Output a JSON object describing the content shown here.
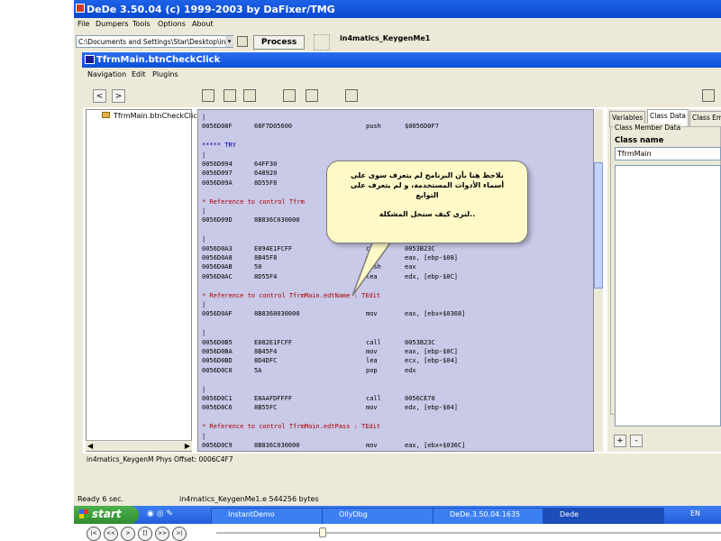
{
  "outer": {
    "title": "DeDe 3.50.04 (c) 1999-2003 by DaFixer/TMG",
    "menu": [
      "File",
      "Dumpers",
      "Tools",
      "Options",
      "About"
    ],
    "path": "C:\\Documents and Settings\\Star\\Desktop\\in",
    "process_label": "Process",
    "project_name": "in4matics_KeygenMe1",
    "status_left": "Ready 6 sec.",
    "status_file": "in4matics_KeygenMe1.e 544256 bytes"
  },
  "inner": {
    "title": "TfrmMain.btnCheckClick",
    "menu": [
      "Navigation",
      "Edit",
      "Plugins"
    ],
    "nav_back": "<",
    "nav_forward": ">",
    "tree_item": "TfrmMain.btnCheckClick",
    "status_project": "in4matics_KeygenM",
    "status_offset": "Phys Offset: 0006C4F7"
  },
  "code_lines": [
    {
      "kind": "plain",
      "text": "|"
    },
    {
      "kind": "asm",
      "addr": "0056D08F",
      "hex": "68F7D05600",
      "mn": "push",
      "op": "$0056D0F7"
    },
    {
      "kind": "blank",
      "text": ""
    },
    {
      "kind": "try",
      "text": "***** TRY"
    },
    {
      "kind": "plain",
      "text": "|"
    },
    {
      "kind": "asm",
      "addr": "0056D094",
      "hex": "64FF30",
      "mn": "",
      "op": ""
    },
    {
      "kind": "asm",
      "addr": "0056D097",
      "hex": "648920",
      "mn": "",
      "op": ""
    },
    {
      "kind": "asm",
      "addr": "0056D09A",
      "hex": "8D55F8",
      "mn": "",
      "op": ""
    },
    {
      "kind": "blank",
      "text": ""
    },
    {
      "kind": "ref",
      "text": "* Reference to control Tfrm"
    },
    {
      "kind": "plain",
      "text": "|"
    },
    {
      "kind": "asm",
      "addr": "0056D09D",
      "hex": "8B836C030000",
      "mn": "",
      "op": ""
    },
    {
      "kind": "blank",
      "text": ""
    },
    {
      "kind": "plain",
      "text": "|"
    },
    {
      "kind": "asm",
      "addr": "0056D0A3",
      "hex": "E894E1FCFF",
      "mn": "call",
      "op": "0053B23C"
    },
    {
      "kind": "asm",
      "addr": "0056D0A8",
      "hex": "8B45F8",
      "mn": "mov",
      "op": "eax, [ebp-$08]"
    },
    {
      "kind": "asm",
      "addr": "0056D0AB",
      "hex": "50",
      "mn": "push",
      "op": "eax"
    },
    {
      "kind": "asm",
      "addr": "0056D0AC",
      "hex": "8D55F4",
      "mn": "lea",
      "op": "edx, [ebp-$0C]"
    },
    {
      "kind": "blank",
      "text": ""
    },
    {
      "kind": "ref",
      "text": "* Reference to control TfrmMain.edtName : TEdit"
    },
    {
      "kind": "plain",
      "text": "|"
    },
    {
      "kind": "asm",
      "addr": "0056D0AF",
      "hex": "8B8368030000",
      "mn": "mov",
      "op": "eax, [ebx+$0368]"
    },
    {
      "kind": "blank",
      "text": ""
    },
    {
      "kind": "plain",
      "text": "|"
    },
    {
      "kind": "asm",
      "addr": "0056D0B5",
      "hex": "E882E1FCFF",
      "mn": "call",
      "op": "0053B23C"
    },
    {
      "kind": "asm",
      "addr": "0056D0BA",
      "hex": "8B45F4",
      "mn": "mov",
      "op": "eax, [ebp-$0C]"
    },
    {
      "kind": "asm",
      "addr": "0056D0BD",
      "hex": "8D4DFC",
      "mn": "lea",
      "op": "ecx, [ebp-$04]"
    },
    {
      "kind": "asm",
      "addr": "0056D0C0",
      "hex": "5A",
      "mn": "pop",
      "op": "edx"
    },
    {
      "kind": "blank",
      "text": ""
    },
    {
      "kind": "plain",
      "text": "|"
    },
    {
      "kind": "asm",
      "addr": "0056D0C1",
      "hex": "E8AAFDFFFF",
      "mn": "call",
      "op": "0056CE70"
    },
    {
      "kind": "asm",
      "addr": "0056D0C6",
      "hex": "8B55FC",
      "mn": "mov",
      "op": "edx, [ebp-$04]"
    },
    {
      "kind": "blank",
      "text": ""
    },
    {
      "kind": "ref",
      "text": "* Reference to control TfrmMain.edtPass : TEdit"
    },
    {
      "kind": "plain",
      "text": "|"
    },
    {
      "kind": "asm",
      "addr": "0056D0C9",
      "hex": "8B836C030000",
      "mn": "mov",
      "op": "eax, [ebx+$036C]"
    }
  ],
  "balloon": {
    "line1": "نلاحظ هنا بأن البرنامج لم يتعرف سوى على",
    "line2": "أسماء الأدوات المستخدمة، و لم يتعرف على",
    "line3": "التوابع",
    "line4": "لنرى كيف سنحل المشكلة..",
    "color": "#fff9c8"
  },
  "right_panel": {
    "tabs": [
      "Variables",
      "Class Data",
      "Class Em"
    ],
    "group_label": "Class Member Data",
    "class_name_label": "Class name",
    "class_name_value": "TfrmMain",
    "add_label": "+",
    "remove_label": "-"
  },
  "taskbar": {
    "start_label": "start",
    "items": [
      "InstantDemo",
      "OllyDbg",
      "DeDe.3.50.04.1635",
      "Dede"
    ],
    "lang": "EN"
  },
  "player": {
    "buttons": [
      "|<",
      "<<",
      ">",
      "[]",
      ">>",
      ">|"
    ],
    "seek_fraction": 0.21
  },
  "colors": {
    "code_bg": "#c9c9e8",
    "reference": "#b00000",
    "titlebar": "#0b4fd6"
  }
}
